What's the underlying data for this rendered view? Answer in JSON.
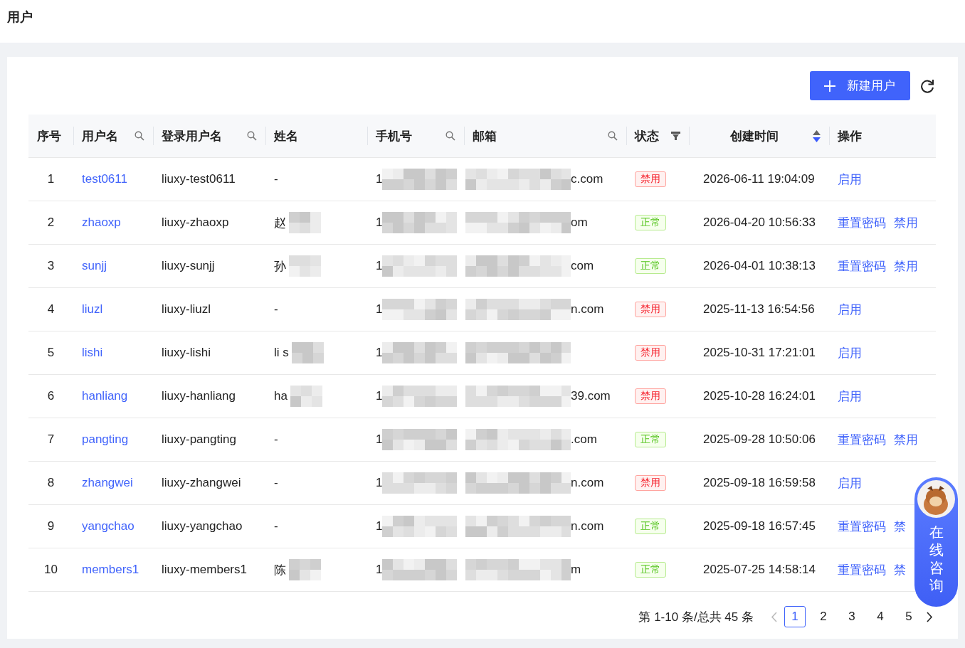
{
  "page_title": "用户",
  "toolbar": {
    "new_button": "新建用户"
  },
  "table": {
    "columns": [
      {
        "label": "序号",
        "kind": "plain"
      },
      {
        "label": "用户名",
        "kind": "search"
      },
      {
        "label": "登录用户名",
        "kind": "search"
      },
      {
        "label": "姓名",
        "kind": "plain"
      },
      {
        "label": "手机号",
        "kind": "search"
      },
      {
        "label": "邮箱",
        "kind": "search"
      },
      {
        "label": "状态",
        "kind": "filter"
      },
      {
        "label": "创建时间",
        "kind": "sort"
      },
      {
        "label": "操作",
        "kind": "plain"
      }
    ],
    "rows": [
      {
        "index": "1",
        "username": "test0611",
        "login": "liuxy-test0611",
        "name": {
          "text": "-",
          "redacted": false
        },
        "phone": {
          "text": "1",
          "redacted": true
        },
        "email": {
          "text": "c.com",
          "redacted": true
        },
        "status": {
          "label": "禁用",
          "kind": "disabled"
        },
        "created": "2026-06-11 19:04:09",
        "actions": [
          "启用"
        ]
      },
      {
        "index": "2",
        "username": "zhaoxp",
        "login": "liuxy-zhaoxp",
        "name": {
          "text": "赵",
          "redacted": true
        },
        "phone": {
          "text": "1",
          "redacted": true
        },
        "email": {
          "text": "om",
          "redacted": true
        },
        "status": {
          "label": "正常",
          "kind": "normal"
        },
        "created": "2026-04-20 10:56:33",
        "actions": [
          "重置密码",
          "禁用"
        ]
      },
      {
        "index": "3",
        "username": "sunjj",
        "login": "liuxy-sunjj",
        "name": {
          "text": "孙",
          "redacted": true
        },
        "phone": {
          "text": "1",
          "redacted": true
        },
        "email": {
          "text": "com",
          "redacted": true
        },
        "status": {
          "label": "正常",
          "kind": "normal"
        },
        "created": "2026-04-01 10:38:13",
        "actions": [
          "重置密码",
          "禁用"
        ]
      },
      {
        "index": "4",
        "username": "liuzl",
        "login": "liuxy-liuzl",
        "name": {
          "text": "-",
          "redacted": false
        },
        "phone": {
          "text": "1",
          "redacted": true
        },
        "email": {
          "text": "n.com",
          "redacted": true
        },
        "status": {
          "label": "禁用",
          "kind": "disabled"
        },
        "created": "2025-11-13 16:54:56",
        "actions": [
          "启用"
        ]
      },
      {
        "index": "5",
        "username": "lishi",
        "login": "liuxy-lishi",
        "name": {
          "text": "li s",
          "redacted": true
        },
        "phone": {
          "text": "1",
          "redacted": true
        },
        "email": {
          "redacted": true
        },
        "status": {
          "label": "禁用",
          "kind": "disabled"
        },
        "created": "2025-10-31 17:21:01",
        "actions": [
          "启用"
        ]
      },
      {
        "index": "6",
        "username": "hanliang",
        "login": "liuxy-hanliang",
        "name": {
          "text": "ha",
          "redacted": true
        },
        "phone": {
          "text": "1",
          "redacted": true
        },
        "email": {
          "text": "39.com",
          "redacted": true
        },
        "status": {
          "label": "禁用",
          "kind": "disabled"
        },
        "created": "2025-10-28 16:24:01",
        "actions": [
          "启用"
        ]
      },
      {
        "index": "7",
        "username": "pangting",
        "login": "liuxy-pangting",
        "name": {
          "text": "-",
          "redacted": false
        },
        "phone": {
          "text": "1",
          "redacted": true
        },
        "email": {
          "text": ".com",
          "redacted": true
        },
        "status": {
          "label": "正常",
          "kind": "normal"
        },
        "created": "2025-09-28 10:50:06",
        "actions": [
          "重置密码",
          "禁用"
        ]
      },
      {
        "index": "8",
        "username": "zhangwei",
        "login": "liuxy-zhangwei",
        "name": {
          "text": "-",
          "redacted": false
        },
        "phone": {
          "text": "1",
          "redacted": true
        },
        "email": {
          "text": "n.com",
          "redacted": true
        },
        "status": {
          "label": "禁用",
          "kind": "disabled"
        },
        "created": "2025-09-18 16:59:58",
        "actions": [
          "启用"
        ]
      },
      {
        "index": "9",
        "username": "yangchao",
        "login": "liuxy-yangchao",
        "name": {
          "text": "-",
          "redacted": false
        },
        "phone": {
          "text": "1",
          "redacted": true
        },
        "email": {
          "text": "n.com",
          "redacted": true
        },
        "status": {
          "label": "正常",
          "kind": "normal"
        },
        "created": "2025-09-18 16:57:45",
        "actions": [
          "重置密码",
          "禁"
        ]
      },
      {
        "index": "10",
        "username": "members1",
        "login": "liuxy-members1",
        "name": {
          "text": "陈",
          "redacted": true
        },
        "phone": {
          "text": "1",
          "redacted": true
        },
        "email": {
          "text": "m",
          "redacted": true
        },
        "status": {
          "label": "正常",
          "kind": "normal"
        },
        "created": "2025-07-25 14:58:14",
        "actions": [
          "重置密码",
          "禁"
        ]
      }
    ]
  },
  "pagination": {
    "summary": "第 1-10 条/总共 45 条",
    "prev_disabled": true,
    "pages": [
      {
        "label": "1",
        "selected": true
      },
      {
        "label": "2",
        "selected": false
      },
      {
        "label": "3",
        "selected": false
      },
      {
        "label": "4",
        "selected": false
      },
      {
        "label": "5",
        "selected": false
      }
    ]
  },
  "chat_widget": {
    "label": "在线咨询"
  }
}
